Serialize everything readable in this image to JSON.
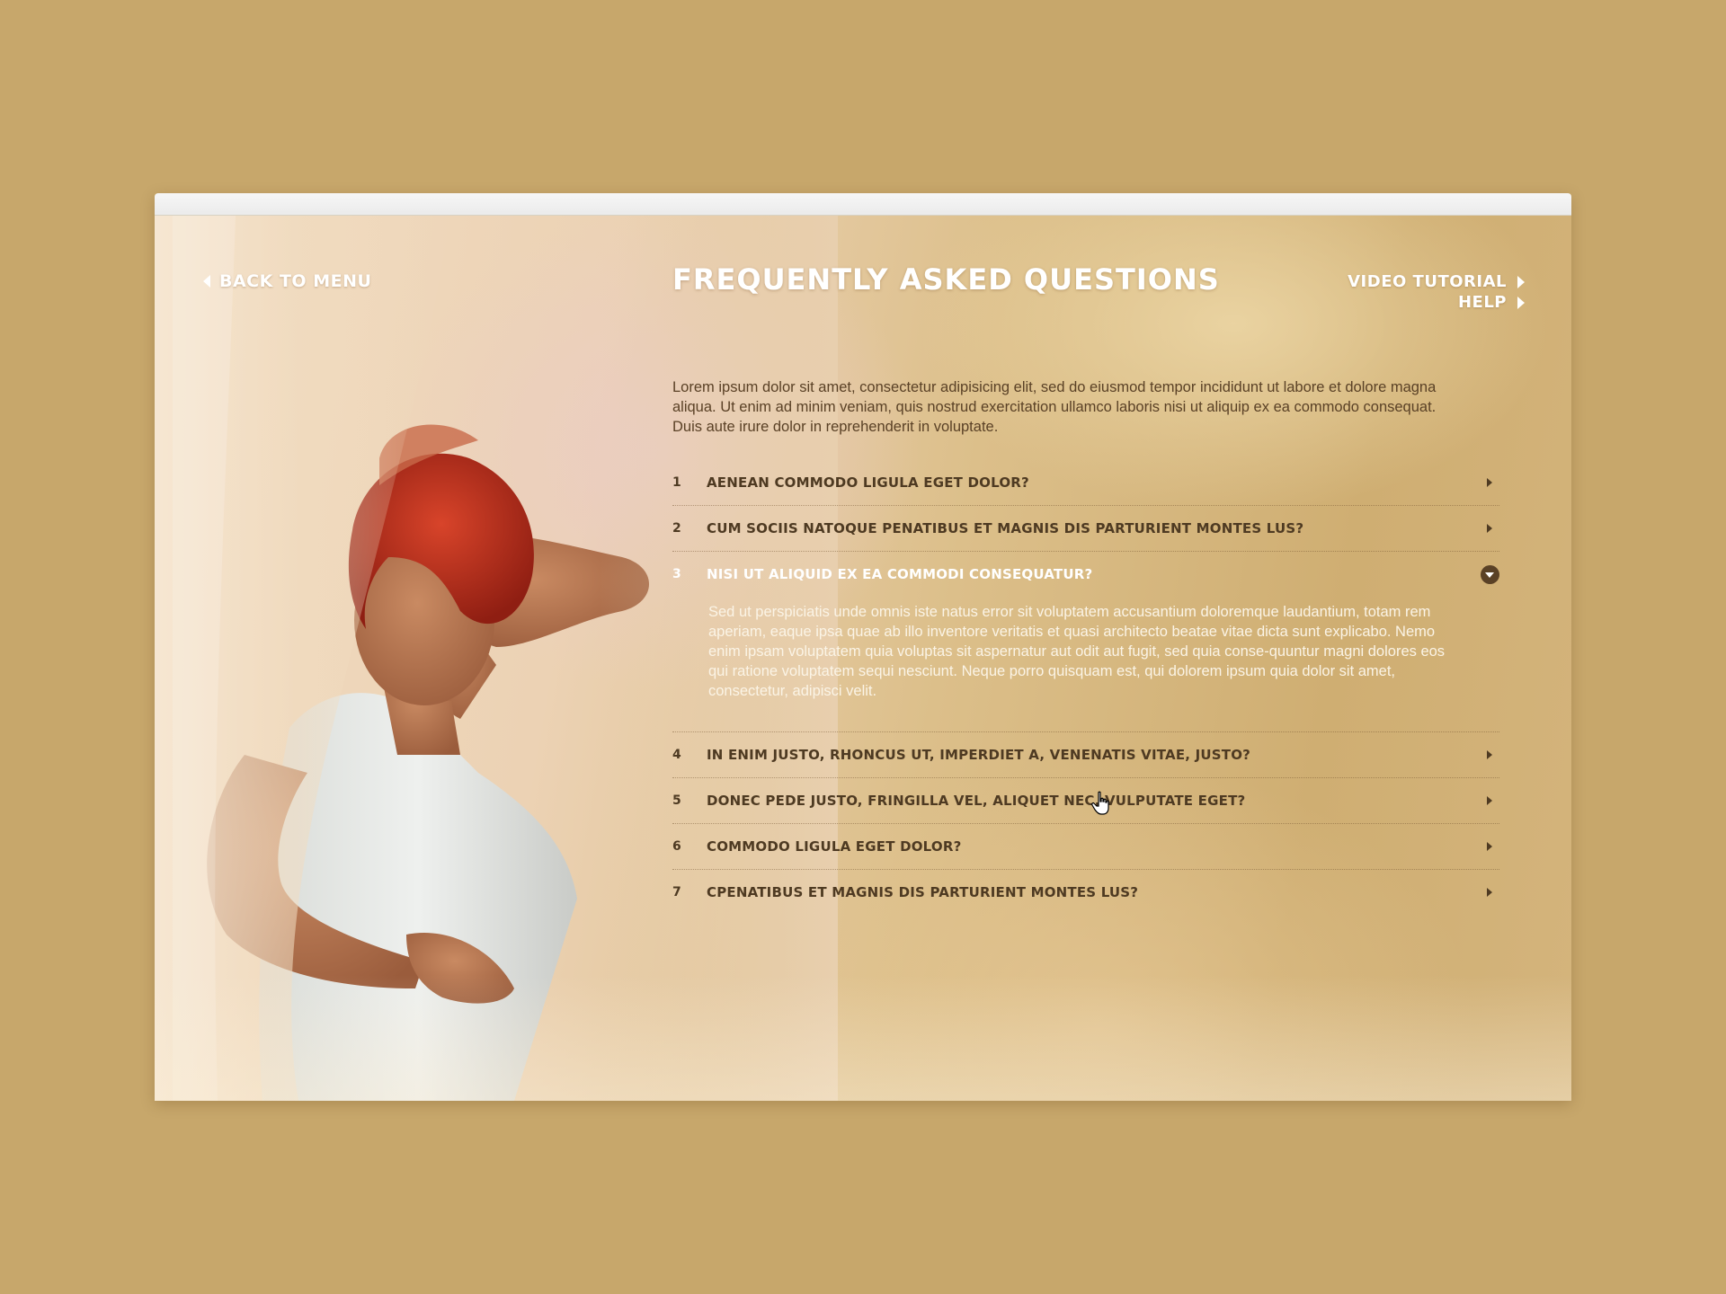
{
  "header": {
    "back_label": "BACK TO MENU",
    "title": "FREQUENTLY ASKED QUESTIONS",
    "video_tutorial_label": "VIDEO TUTORIAL",
    "help_label": "HELP"
  },
  "intro": "Lorem ipsum dolor sit amet, consectetur adipisicing elit, sed do eiusmod tempor incididunt ut labore et dolore magna aliqua. Ut enim ad minim veniam, quis nostrud exercitation ullamco laboris nisi ut aliquip ex ea commodo consequat. Duis aute irure dolor in reprehenderit in voluptate.",
  "faq": [
    {
      "num": "1",
      "question": "AENEAN COMMODO LIGULA EGET DOLOR?",
      "expanded": false
    },
    {
      "num": "2",
      "question": "CUM SOCIIS NATOQUE PENATIBUS ET MAGNIS DIS PARTURIENT MONTES LUS?",
      "expanded": false
    },
    {
      "num": "3",
      "question": "NISI UT ALIQUID EX EA COMMODI CONSEQUATUR?",
      "expanded": true,
      "answer": "Sed ut perspiciatis unde omnis iste natus error sit voluptatem accusantium doloremque laudantium, totam rem aperiam, eaque ipsa quae ab illo inventore veritatis et quasi architecto beatae vitae dicta sunt explicabo. Nemo enim ipsam voluptatem quia voluptas sit aspernatur aut odit aut fugit, sed quia conse-quuntur magni dolores eos qui ratione voluptatem sequi nesciunt. Neque porro quisquam est, qui dolorem ipsum quia dolor sit amet, consectetur, adipisci velit."
    },
    {
      "num": "4",
      "question": "IN ENIM JUSTO, RHONCUS UT, IMPERDIET A, VENENATIS VITAE, JUSTO?",
      "expanded": false
    },
    {
      "num": "5",
      "question": "DONEC PEDE JUSTO, FRINGILLA VEL, ALIQUET NEC, VULPUTATE EGET?",
      "expanded": false
    },
    {
      "num": "6",
      "question": "COMMODO LIGULA EGET DOLOR?",
      "expanded": false
    },
    {
      "num": "7",
      "question": "CPENATIBUS ET MAGNIS DIS PARTURIENT MONTES LUS?",
      "expanded": false
    }
  ],
  "colors": {
    "page_background": "#c7a76b",
    "text_dark": "#4e3a22",
    "text_light": "#ffffff"
  },
  "icons": {
    "back": "chevron-left-icon",
    "link": "chevron-right-icon",
    "collapsed": "chevron-right-icon",
    "expanded": "chevron-down-circle-icon",
    "cursor": "hand-pointer-icon"
  }
}
